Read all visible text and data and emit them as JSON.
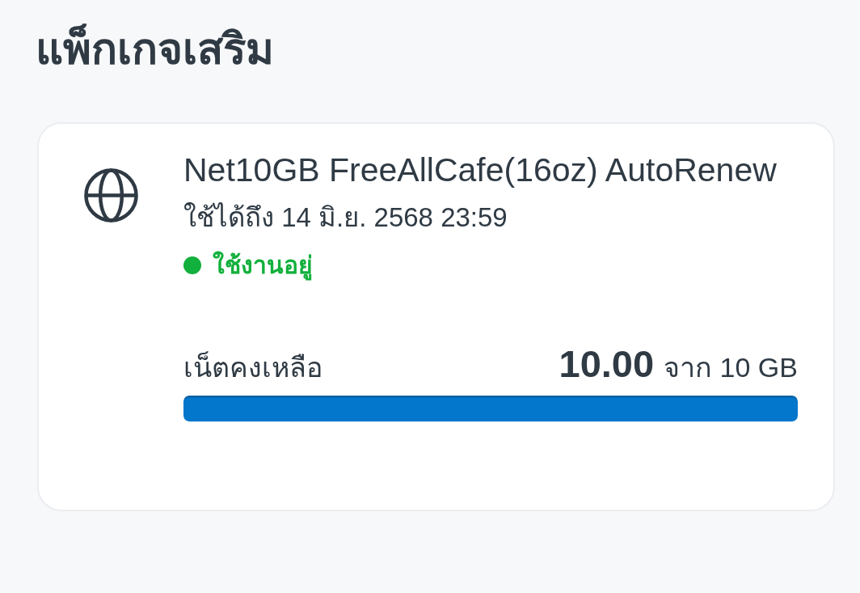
{
  "page_title": "แพ็กเกจเสริม",
  "packages": [
    {
      "name": "Net10GB FreeAllCafe(16oz) AutoRenew",
      "valid_until": "ใช้ได้ถึง 14 มิ.ย. 2568 23:59",
      "status": {
        "label": "ใช้งานอยู่",
        "active": true
      },
      "remaining": {
        "label": "เน็ตคงเหลือ",
        "amount": "10.00",
        "total": "จาก 10 GB",
        "level": 1
      }
    }
  ]
}
